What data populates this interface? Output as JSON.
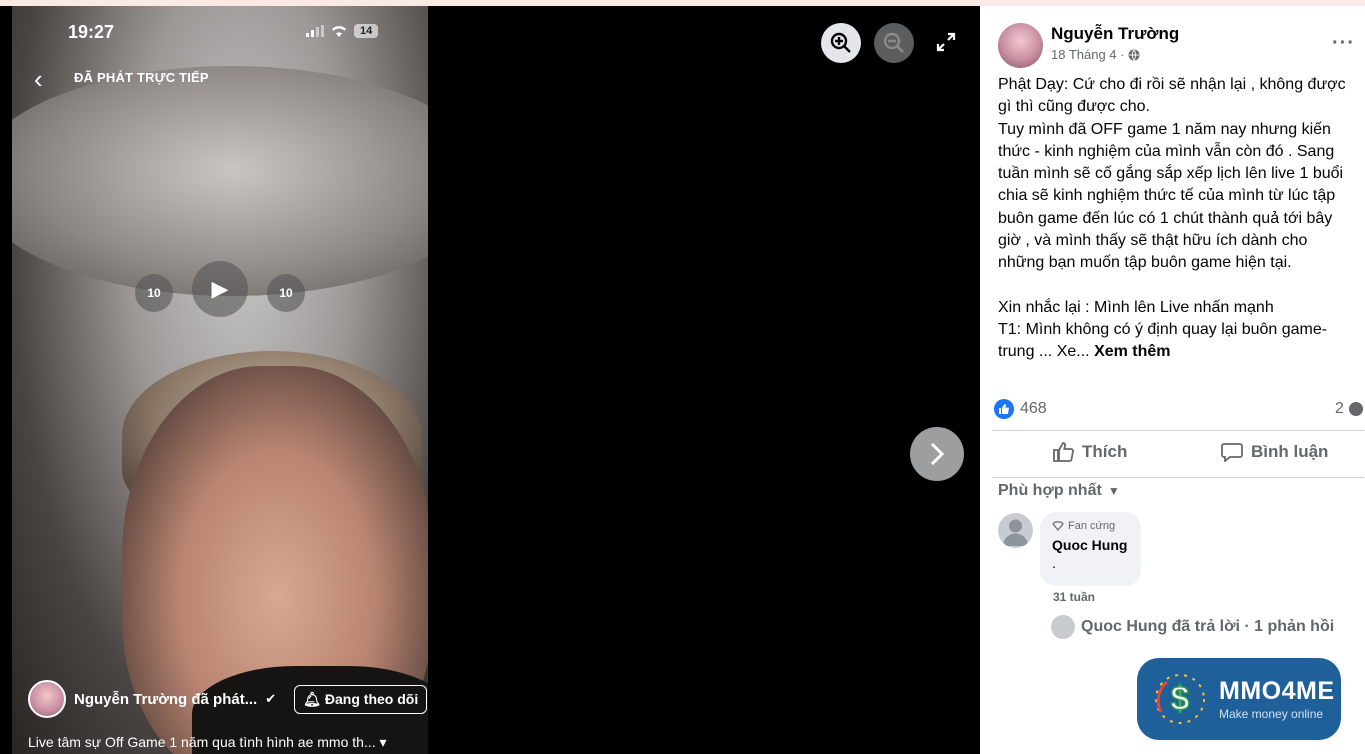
{
  "viewer": {
    "status_time": "19:27",
    "battery": "14",
    "live_label": "ĐÃ PHÁT TRỰC TIẾP",
    "owner_name": "Nguyễn Trường đã phát...",
    "follow_label": "Đang theo dõi",
    "caption": "Live tâm sự Off Game 1 năm qua tình hình ae mmo th...",
    "rewind_label": "10",
    "forward_label": "10"
  },
  "post": {
    "author": "Nguyễn Trường",
    "date": "18 Tháng 4 ·",
    "paragraphs": [
      "Phật Dạy: Cứ cho đi rồi sẽ nhận lại , không được gì thì cũng được cho.",
      "Tuy mình đã OFF game 1 năm nay nhưng kiến thức - kinh nghiệm của mình vẫn còn đó . Sang tuần mình sẽ cố gắng sắp xếp lịch lên live 1 buổi chia sẽ kinh nghiệm thức tế của mình từ lúc tập buôn game đến lúc có 1 chút thành quả tới bây giờ , và mình thấy sẽ thật hữu ích dành cho những bạn muốn tập buôn game hiện tại.",
      "",
      "Xin nhắc lại : Mình lên Live nhấn mạnh",
      "T1: Mình không có ý định quay lại buôn game-trung ... Xe..."
    ],
    "see_more": "Xem thêm",
    "like_count": "468",
    "comment_count": "2",
    "like_action": "Thích",
    "comment_action": "Bình luận",
    "sort_label": "Phù hợp nhất"
  },
  "comment": {
    "badge": "Fan cứng",
    "name": "Quoc Hung",
    "body": ".",
    "time": "31 tuần",
    "reply_summary": "Quoc Hung đã trả lời · 1 phản hồi"
  },
  "watermark": {
    "title": "MMO4ME",
    "subtitle": "Make money online"
  }
}
